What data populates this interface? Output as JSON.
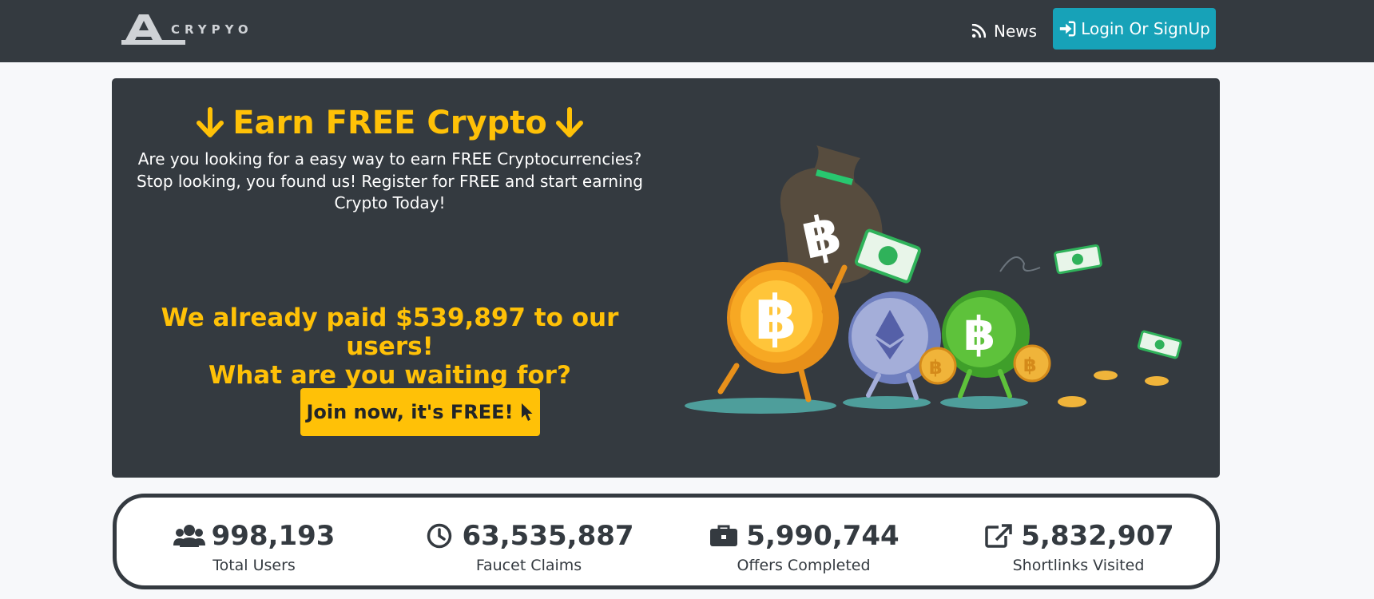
{
  "nav": {
    "logo_text": "CRYPYO",
    "news_label": "News",
    "login_label": "Login Or SignUp"
  },
  "hero": {
    "title": "Earn FREE Crypto",
    "description_line1": "Are you looking for a easy way to earn FREE Cryptocurrencies?",
    "description_line2": "Stop looking, you found us! Register for FREE and start earning",
    "description_line3": "Crypto Today!",
    "paid_line1": "We already paid $539,897 to our users!",
    "paid_line2": "What are you waiting for?",
    "join_label": "Join now, it's FREE!"
  },
  "stats": [
    {
      "value": "998,193",
      "label": "Total Users",
      "icon": "users-icon"
    },
    {
      "value": "63,535,887",
      "label": "Faucet Claims",
      "icon": "clock-icon"
    },
    {
      "value": "5,990,744",
      "label": "Offers Completed",
      "icon": "briefcase-icon"
    },
    {
      "value": "5,832,907",
      "label": "Shortlinks Visited",
      "icon": "external-link-icon"
    }
  ],
  "colors": {
    "navbar": "#343a40",
    "accent": "#ffc107",
    "login": "#17a2b8",
    "page": "#f7f8fa"
  }
}
